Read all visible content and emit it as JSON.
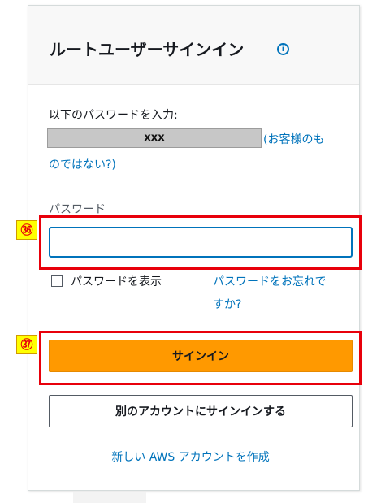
{
  "header": {
    "title": "ルートユーザーサインイン",
    "info_icon_text": "i"
  },
  "account": {
    "label": "以下のパスワードを入力:",
    "masked_email": "xxx",
    "not_you_line1": "(お客様のも",
    "not_you_line2": "のではない?)"
  },
  "password": {
    "label": "パスワード",
    "value": "",
    "show_password_label": "パスワードを表示",
    "forgot_line1": "パスワードをお忘れで",
    "forgot_line2": "すか?"
  },
  "annotations": {
    "marker_36": "㊱",
    "marker_37": "㊲",
    "highlight_color": "#e8000b",
    "badge_color": "#ffff00"
  },
  "buttons": {
    "sign_in": "サインイン",
    "other_account": "別のアカウントにサインインする"
  },
  "footer": {
    "create_account": "新しい AWS アカウントを作成"
  },
  "colors": {
    "primary_button": "#ff9900",
    "link": "#0073bb",
    "input_focus": "#0073bb"
  }
}
